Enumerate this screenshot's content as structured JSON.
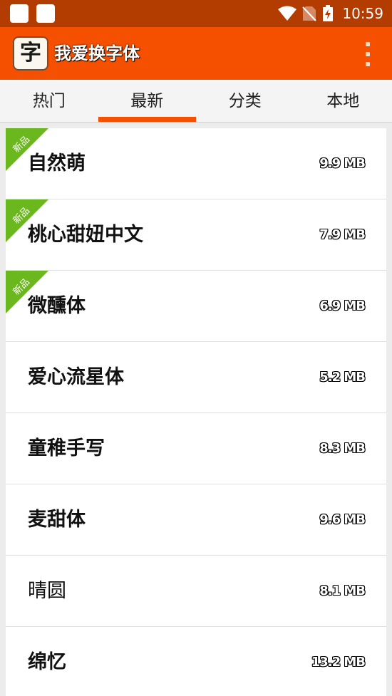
{
  "status_bar": {
    "time": "10:59"
  },
  "app_bar": {
    "icon_char": "字",
    "title": "我爱换字体",
    "menu_icon": "overflow-menu-icon"
  },
  "tabs": [
    {
      "label": "热门",
      "active": false
    },
    {
      "label": "最新",
      "active": true
    },
    {
      "label": "分类",
      "active": false
    },
    {
      "label": "本地",
      "active": false
    }
  ],
  "badge_label": "新品",
  "fonts": [
    {
      "name": "自然萌",
      "size": "9.9 MB",
      "is_new": true
    },
    {
      "name": "桃心甜妞中文",
      "size": "7.9 MB",
      "is_new": true
    },
    {
      "name": "微醺体",
      "size": "6.9 MB",
      "is_new": true
    },
    {
      "name": "爱心流星体",
      "size": "5.2 MB",
      "is_new": false
    },
    {
      "name": "童稚手写",
      "size": "8.3 MB",
      "is_new": false
    },
    {
      "name": "麦甜体",
      "size": "9.6 MB",
      "is_new": false
    },
    {
      "name": "晴圆",
      "size": "8.1 MB",
      "is_new": false
    },
    {
      "name": "绵忆",
      "size": "13.2 MB",
      "is_new": false
    }
  ],
  "colors": {
    "status_bar": "#b33c00",
    "accent": "#f45000",
    "new_badge": "#6bb81e"
  }
}
